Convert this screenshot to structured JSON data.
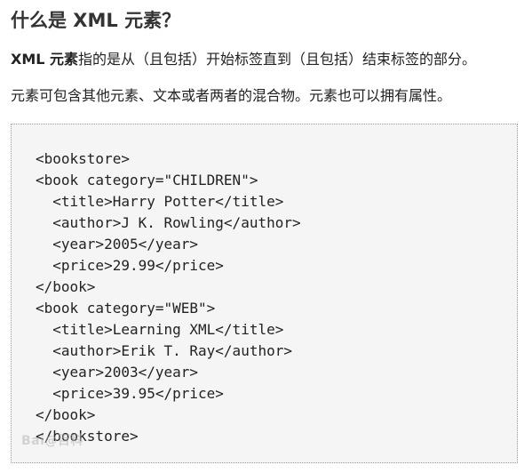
{
  "heading": "什么是 XML 元素？",
  "intro": {
    "bold_term": "XML 元素",
    "rest": "指的是从（且包括）开始标签直到（且包括）结束标签的部分。"
  },
  "note": "元素可包含其他元素、文本或者两者的混合物。元素也可以拥有属性。",
  "code_lines": [
    "<bookstore>",
    "<book category=\"CHILDREN\">",
    "  <title>Harry Potter</title>",
    "  <author>J K. Rowling</author>",
    "  <year>2005</year>",
    "  <price>29.99</price>",
    "</book>",
    "<book category=\"WEB\">",
    "  <title>Learning XML</title>",
    "  <author>Erik T. Ray</author>",
    "  <year>2003</year>",
    "  <price>39.95</price>",
    "</book>",
    "</bookstore>"
  ],
  "watermark": "Bai@百科"
}
